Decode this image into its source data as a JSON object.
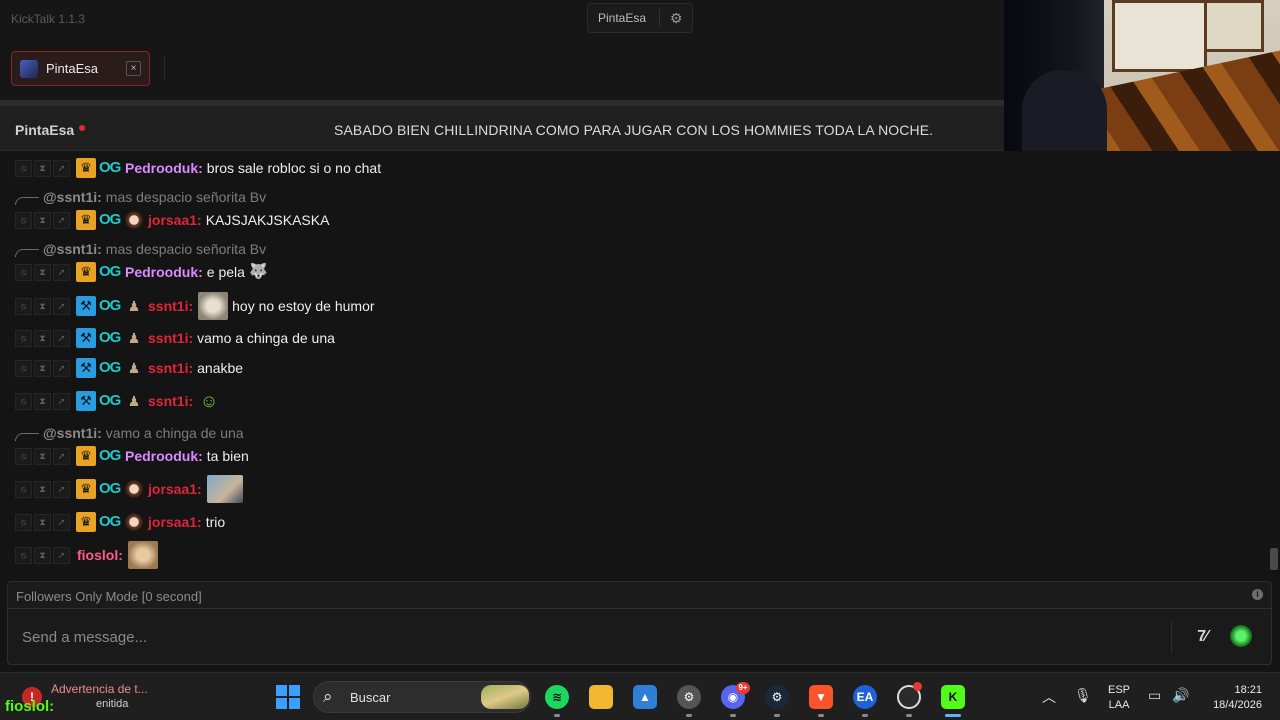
{
  "app": {
    "title": "KickTalk 1.1.3"
  },
  "top_center": {
    "channel_label": "PintaEsa"
  },
  "tabs": [
    {
      "label": "PintaEsa",
      "close": "×"
    }
  ],
  "chat_header": {
    "channel": "PintaEsa",
    "stream_title": "SABADO BIEN CHILLINDRINA COMO PARA JUGAR CON LOS HOMMIES TODA LA NOCHE."
  },
  "messages": [
    {
      "user": "Pedrooduk:",
      "text": "bros sale robloc si o no chat"
    },
    {
      "reply_user": "@ssnt1i:",
      "reply_text": "mas despacio señorita Bv"
    },
    {
      "user": "jorsaa1:",
      "text": "KAJSJAKJSKASKA"
    },
    {
      "reply_user": "@ssnt1i:",
      "reply_text": "mas despacio señorita Bv"
    },
    {
      "user": "Pedrooduk:",
      "text": "e pela"
    },
    {
      "user": "ssnt1i:",
      "text": "hoy no estoy de humor"
    },
    {
      "user": "ssnt1i:",
      "text": "vamo a chinga de una"
    },
    {
      "user": "ssnt1i:",
      "text": "anakbe"
    },
    {
      "user": "ssnt1i:",
      "text": ""
    },
    {
      "reply_user": "@ssnt1i:",
      "reply_text": "vamo a chinga de una"
    },
    {
      "user": "Pedrooduk:",
      "text": "ta bien"
    },
    {
      "user": "jorsaa1:",
      "text": ""
    },
    {
      "user": "jorsaa1:",
      "text": "trio"
    },
    {
      "user": "fioslol:",
      "text": ""
    }
  ],
  "chat_mode": {
    "text": "Followers Only Mode [0 second]"
  },
  "input": {
    "placeholder": "Send a message..."
  },
  "buttons": {
    "seventv": "7tv"
  },
  "taskbar": {
    "notification_title": "Advertencia de t...",
    "notification_sub": "enitida",
    "overlay_text": "fioslol:",
    "search_label": "Buscar",
    "discord_badge": "9+",
    "lang_top": "ESP",
    "lang_bottom": "LAA",
    "time": "18:21",
    "date": "18/4/2026"
  },
  "colors": {
    "accent_kick": "#53fc18",
    "live_dot": "#e0263a",
    "tab_border": "#8c2424"
  }
}
